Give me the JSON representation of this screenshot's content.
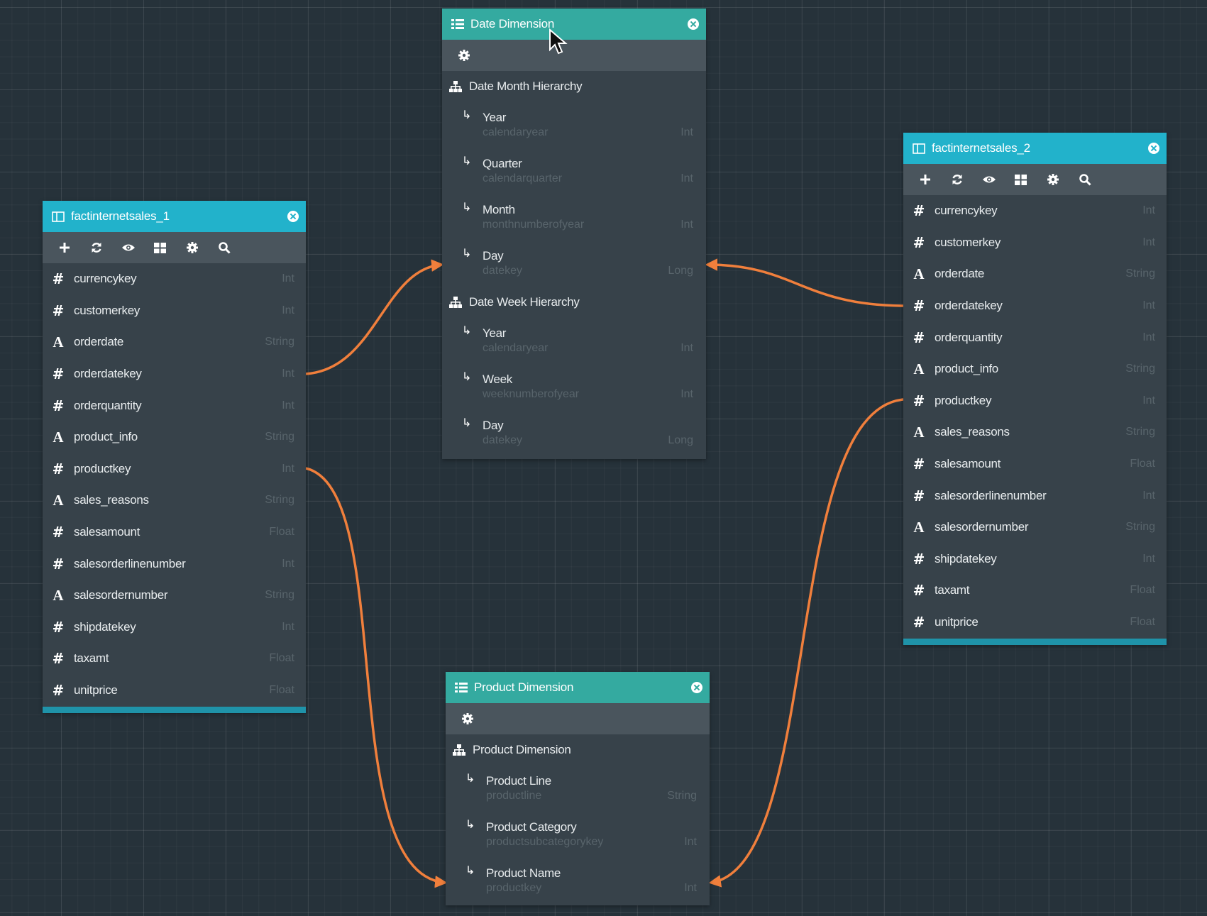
{
  "colors": {
    "link": "#f07f3c",
    "canvas": "#26323a",
    "header_teal": "#34aaa0",
    "header_cyan": "#22b2cb"
  },
  "fact_columns": [
    {
      "name": "currencykey",
      "type": "Int",
      "kind": "number"
    },
    {
      "name": "customerkey",
      "type": "Int",
      "kind": "number"
    },
    {
      "name": "orderdate",
      "type": "String",
      "kind": "text"
    },
    {
      "name": "orderdatekey",
      "type": "Int",
      "kind": "number"
    },
    {
      "name": "orderquantity",
      "type": "Int",
      "kind": "number"
    },
    {
      "name": "product_info",
      "type": "String",
      "kind": "text"
    },
    {
      "name": "productkey",
      "type": "Int",
      "kind": "number"
    },
    {
      "name": "sales_reasons",
      "type": "String",
      "kind": "text"
    },
    {
      "name": "salesamount",
      "type": "Float",
      "kind": "number"
    },
    {
      "name": "salesorderlinenumber",
      "type": "Int",
      "kind": "number"
    },
    {
      "name": "salesordernumber",
      "type": "String",
      "kind": "text"
    },
    {
      "name": "shipdatekey",
      "type": "Int",
      "kind": "number"
    },
    {
      "name": "taxamt",
      "type": "Float",
      "kind": "number"
    },
    {
      "name": "unitprice",
      "type": "Float",
      "kind": "number"
    }
  ],
  "toolbar_icons": [
    "plus-icon",
    "refresh-icon",
    "eye-icon",
    "grid-icon",
    "gear-icon",
    "search-icon"
  ],
  "fact1": {
    "title": "factinternetsales_1"
  },
  "fact2": {
    "title": "factinternetsales_2"
  },
  "date_dim": {
    "title": "Date Dimension",
    "hierarchies": [
      {
        "name": "Date Month Hierarchy",
        "levels": [
          {
            "name": "Year",
            "column": "calendaryear",
            "type": "Int"
          },
          {
            "name": "Quarter",
            "column": "calendarquarter",
            "type": "Int"
          },
          {
            "name": "Month",
            "column": "monthnumberofyear",
            "type": "Int"
          },
          {
            "name": "Day",
            "column": "datekey",
            "type": "Long"
          }
        ]
      },
      {
        "name": "Date Week Hierarchy",
        "levels": [
          {
            "name": "Year",
            "column": "calendaryear",
            "type": "Int"
          },
          {
            "name": "Week",
            "column": "weeknumberofyear",
            "type": "Int"
          },
          {
            "name": "Day",
            "column": "datekey",
            "type": "Long"
          }
        ]
      }
    ]
  },
  "product_dim": {
    "title": "Product Dimension",
    "hierarchies": [
      {
        "name": "Product Dimension",
        "levels": [
          {
            "name": "Product Line",
            "column": "productline",
            "type": "String"
          },
          {
            "name": "Product Category",
            "column": "productsubcategorykey",
            "type": "Int"
          },
          {
            "name": "Product Name",
            "column": "productkey",
            "type": "Int"
          }
        ]
      }
    ]
  }
}
